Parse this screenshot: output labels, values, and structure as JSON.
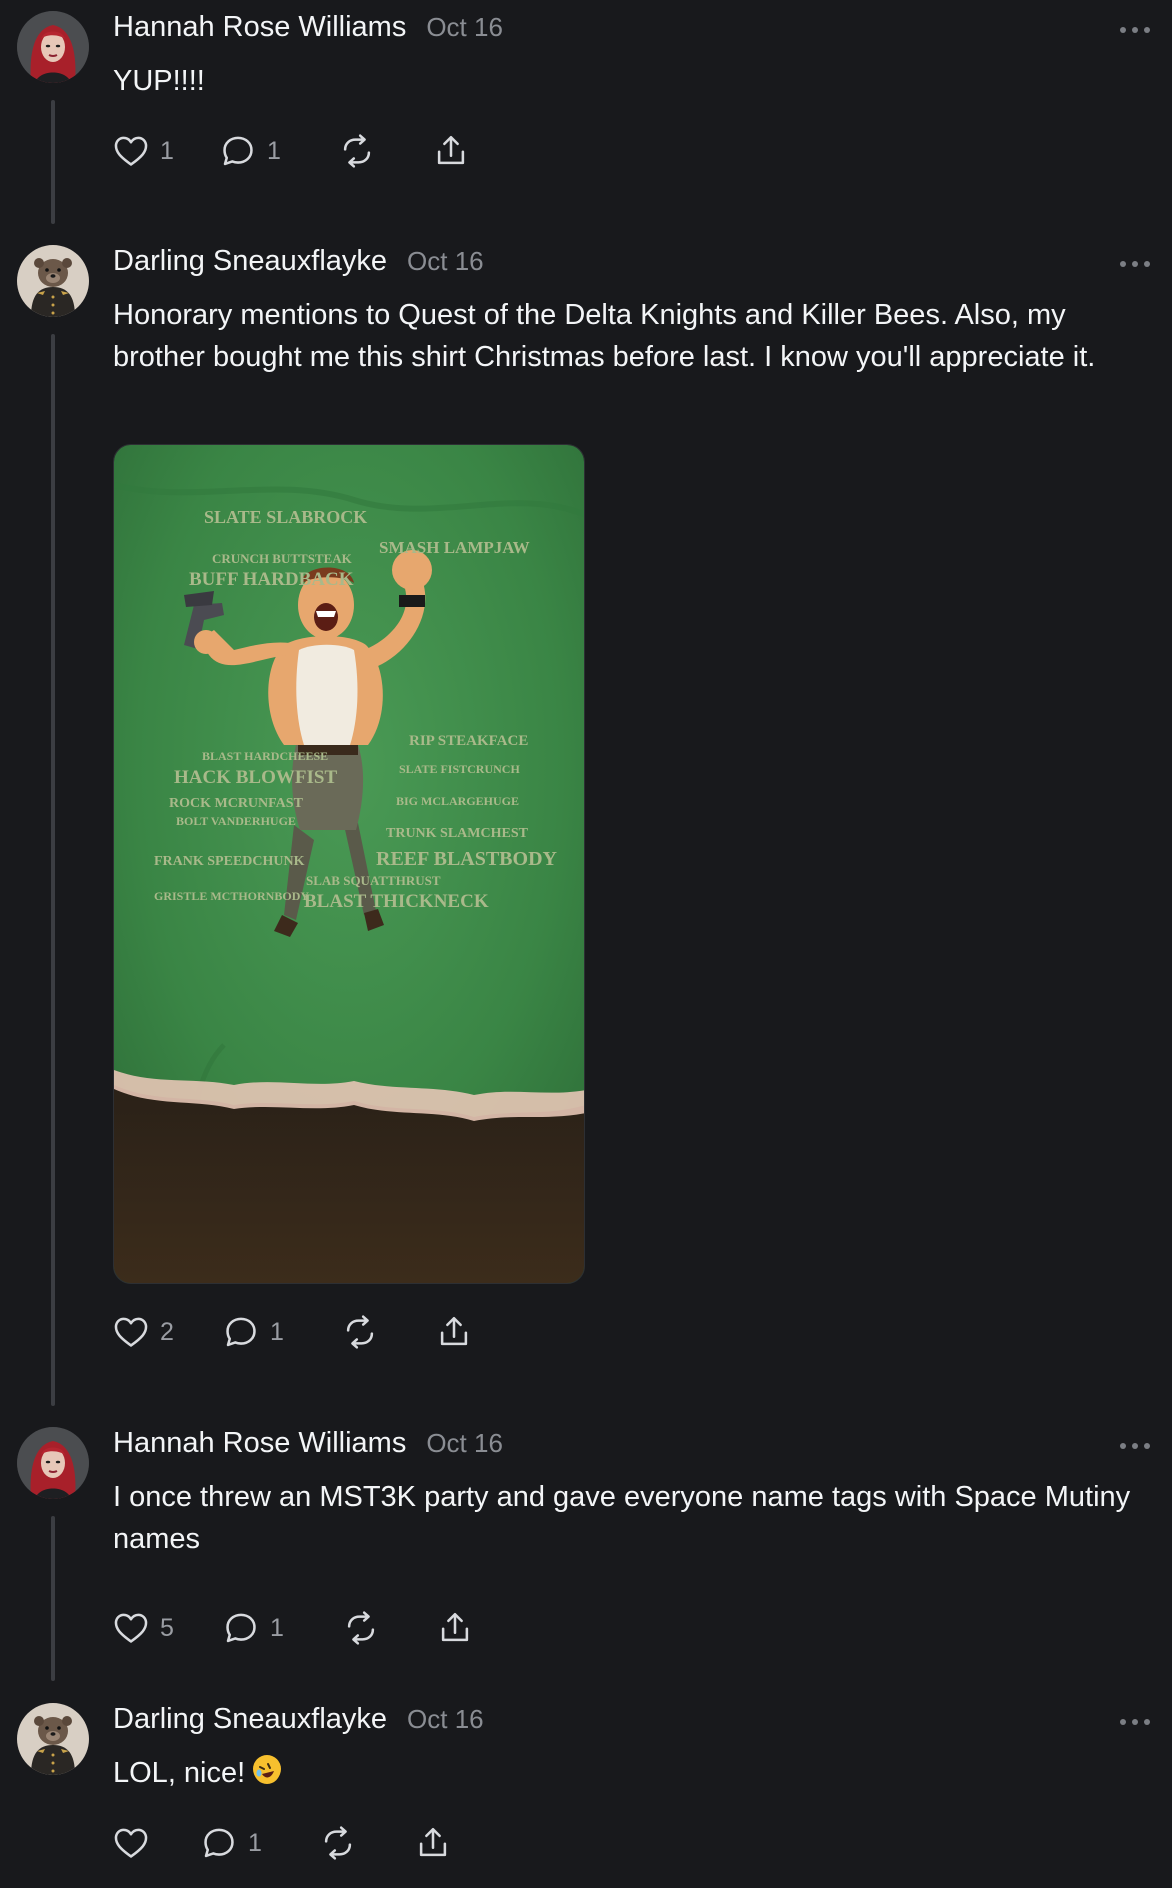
{
  "posts": [
    {
      "author": "Hannah Rose Williams",
      "date": "Oct 16",
      "text": "YUP!!!!",
      "likes": "1",
      "comments": "1",
      "avatar": "red-haired-woman"
    },
    {
      "author": "Darling Sneauxflayke",
      "date": "Oct 16",
      "text": "Honorary mentions to Quest of the Delta Knights and Killer Bees. Also, my brother bought me this shirt Christmas before last. I know you'll appreciate it.",
      "likes": "2",
      "comments": "1",
      "avatar": "dog-in-uniform",
      "image": {
        "subject": "green t-shirt with muscular cartoon hero holding a ray gun",
        "shirt_names": {
          "n1": "SLATE SLABROCK",
          "n2": "SMASH LAMPJAW",
          "n3": "CRUNCH BUTTSTEAK",
          "n4": "BUFF HARDBACK",
          "n5": "RIP STEAKFACE",
          "n6": "BLAST HARDCHEESE",
          "n7": "HACK BLOWFIST",
          "n8": "SLATE FISTCRUNCH",
          "n9": "BOLT VANDERHUGE",
          "n10": "ROCK MCRUNFAST",
          "n11": "BIG MCLARGEHUGE",
          "n12": "TRUNK SLAMCHEST",
          "n13": "FRANK SPEEDCHUNK",
          "n14": "REEF BLASTBODY",
          "n15": "SLAB SQUATTHRUST",
          "n16": "GRISTLE MCTHORNBODY",
          "n17": "BLAST THICKNECK"
        }
      }
    },
    {
      "author": "Hannah Rose Williams",
      "date": "Oct 16",
      "text": "I once threw an MST3K party and gave everyone name tags with Space Mutiny names",
      "likes": "5",
      "comments": "1",
      "avatar": "red-haired-woman"
    },
    {
      "author": "Darling Sneauxflayke",
      "date": "Oct 16",
      "text": "LOL, nice!",
      "emoji": "rolling-on-floor-laughing",
      "likes": "",
      "comments": "1",
      "avatar": "dog-in-uniform"
    }
  ],
  "icons": {
    "like": "heart-icon",
    "comment": "speech-bubble-icon",
    "repost": "repost-arrows-icon",
    "share": "share-upload-icon",
    "more": "more-dots-icon"
  },
  "colors": {
    "background": "#18191c",
    "text_primary": "#f3f5f7",
    "text_secondary": "#8a8d93",
    "thread_line": "#3b3d42",
    "shirt_green": "#3f8f4c"
  }
}
